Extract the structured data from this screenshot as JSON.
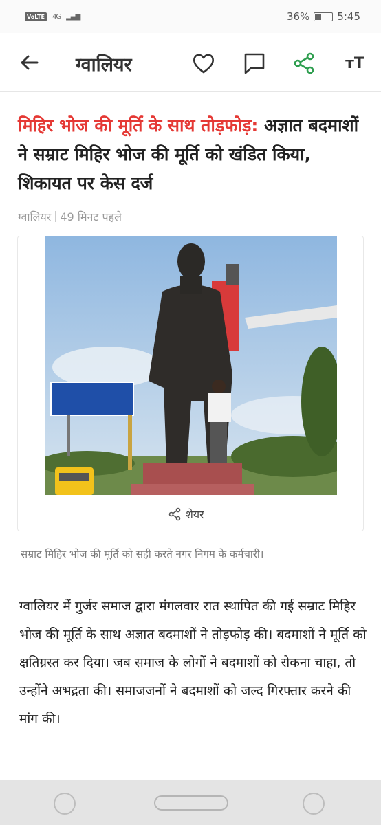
{
  "status_bar": {
    "volte": "VoLTE",
    "network": "4G",
    "battery": "36%",
    "battery_level": 0.36,
    "time": "5:45"
  },
  "app_bar": {
    "title": "ग्वालियर",
    "icons": [
      "back-arrow-icon",
      "heart-icon",
      "comment-icon",
      "share-icon",
      "font-size-icon"
    ],
    "font_label": "тT",
    "share_color": "#2e9e4f"
  },
  "article": {
    "kicker": "मिहिर भोज की मूर्ति के साथ तोड़फोड़:",
    "headline": "अज्ञात बदमाशों ने सम्राट मिहिर भोज की मूर्ति को खंडित किया, शिकायत पर केस दर्ज",
    "location": "ग्वालियर",
    "time_ago": "49 मिनट पहले",
    "image_share_label": "शेयर",
    "caption": "सम्राट मिहिर भोज की मूर्ति को सही करते नगर निगम के कर्मचारी।",
    "body": "ग्वालियर में गुर्जर समाज द्वारा मंगलवार रात स्थापित की गई सम्राट मिहिर भोज की मूर्ति के साथ अज्ञात बदमाशों ने तोड़फोड़ की। बदमाशों ने मूर्ति को क्षतिग्रस्त कर दिया। जब समाज के लोगों ने बदमाशों को रोकना चाहा, तो उन्होंने अभद्रता की। समाजजनों ने बदमाशों को जल्द गिरफ्तार करने की मांग की।"
  },
  "colors": {
    "kicker": "#e53935",
    "accent": "#2e9e4f"
  }
}
